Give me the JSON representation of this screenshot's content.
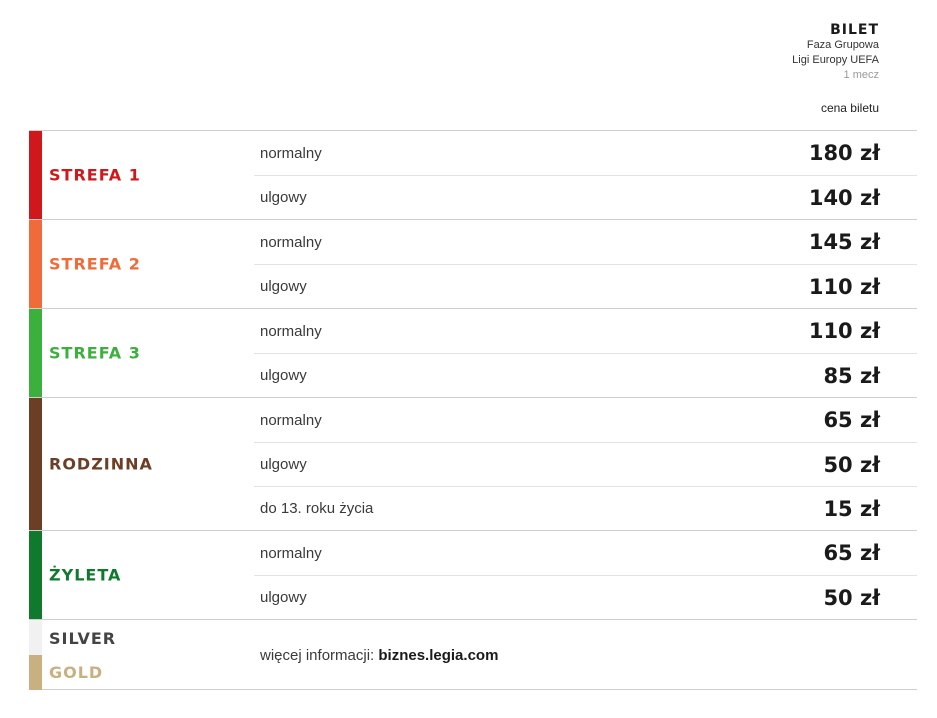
{
  "header": {
    "title": "BILET",
    "line1": "Faza Grupowa",
    "line2": "Ligi Europy UEFA",
    "line3": "1 mecz"
  },
  "column_label": "cena biletu",
  "zones": [
    {
      "name": "STREFA 1",
      "color": "#d0171b",
      "rows": [
        {
          "type": "normalny",
          "price": "180 zł"
        },
        {
          "type": "ulgowy",
          "price": "140 zł"
        }
      ]
    },
    {
      "name": "STREFA 2",
      "color": "#ef6b3a",
      "rows": [
        {
          "type": "normalny",
          "price": "145 zł"
        },
        {
          "type": "ulgowy",
          "price": "110 zł"
        }
      ]
    },
    {
      "name": "STREFA 3",
      "color": "#3cb03c",
      "rows": [
        {
          "type": "normalny",
          "price": "110 zł"
        },
        {
          "type": "ulgowy",
          "price": "85 zł"
        }
      ]
    },
    {
      "name": "RODZINNA",
      "color": "#6b3e26",
      "rows": [
        {
          "type": "normalny",
          "price": "65 zł"
        },
        {
          "type": "ulgowy",
          "price": "50 zł"
        },
        {
          "type": "do 13. roku życia",
          "price": "15 zł"
        }
      ]
    },
    {
      "name": "ŻYLETA",
      "color": "#0f7a2e",
      "rows": [
        {
          "type": "normalny",
          "price": "65 zł"
        },
        {
          "type": "ulgowy",
          "price": "50 zł"
        }
      ]
    }
  ],
  "bottom": {
    "silver": {
      "name": "SILVER",
      "color": "#444444",
      "bar_color": "#f1f1f1"
    },
    "gold": {
      "name": "GOLD",
      "color": "#c8b080",
      "bar_color": "#c8b080"
    },
    "more_prefix": "więcej informacji:",
    "more_link": "biznes.legia.com"
  }
}
